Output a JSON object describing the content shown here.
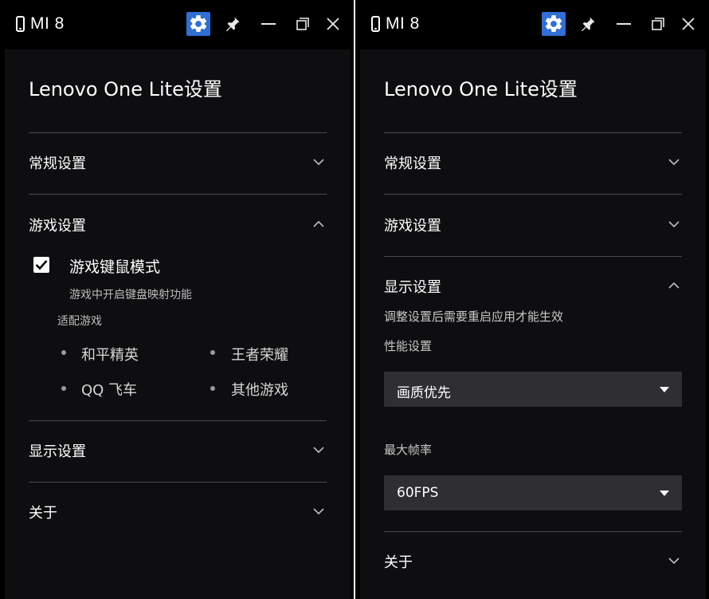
{
  "left": {
    "device_name": "MI 8",
    "app_title": "Lenovo One Lite设置",
    "sections": {
      "general": "常规设置",
      "game": "游戏设置",
      "display": "显示设置",
      "about": "关于"
    },
    "game_settings": {
      "keymouse_label": "游戏键鼠模式",
      "keymouse_checked": true,
      "keymouse_desc": "游戏中开启键盘映射功能",
      "supported_label": "适配游戏",
      "games": [
        "和平精英",
        "王者荣耀",
        "QQ 飞车",
        "其他游戏"
      ]
    }
  },
  "right": {
    "device_name": "MI 8",
    "app_title": "Lenovo One Lite设置",
    "sections": {
      "general": "常规设置",
      "game": "游戏设置",
      "display": "显示设置",
      "about": "关于"
    },
    "display_settings": {
      "hint": "调整设置后需要重启应用才能生效",
      "performance_label": "性能设置",
      "performance_value": "画质优先",
      "fps_label": "最大帧率",
      "fps_value": "60FPS"
    }
  },
  "icons": {
    "titlebar": [
      "phone-icon",
      "gear-icon",
      "pin-icon",
      "minimize-icon",
      "maximize-icon",
      "close-icon"
    ],
    "section": [
      "chevron-down-icon",
      "chevron-up-icon"
    ]
  },
  "colors": {
    "window_bg": "#000000",
    "panel_bg": "#0e0e10",
    "accent": "#2f6fd6",
    "divider": "#4a4a4e",
    "dropdown_bg": "#2f2f33"
  }
}
